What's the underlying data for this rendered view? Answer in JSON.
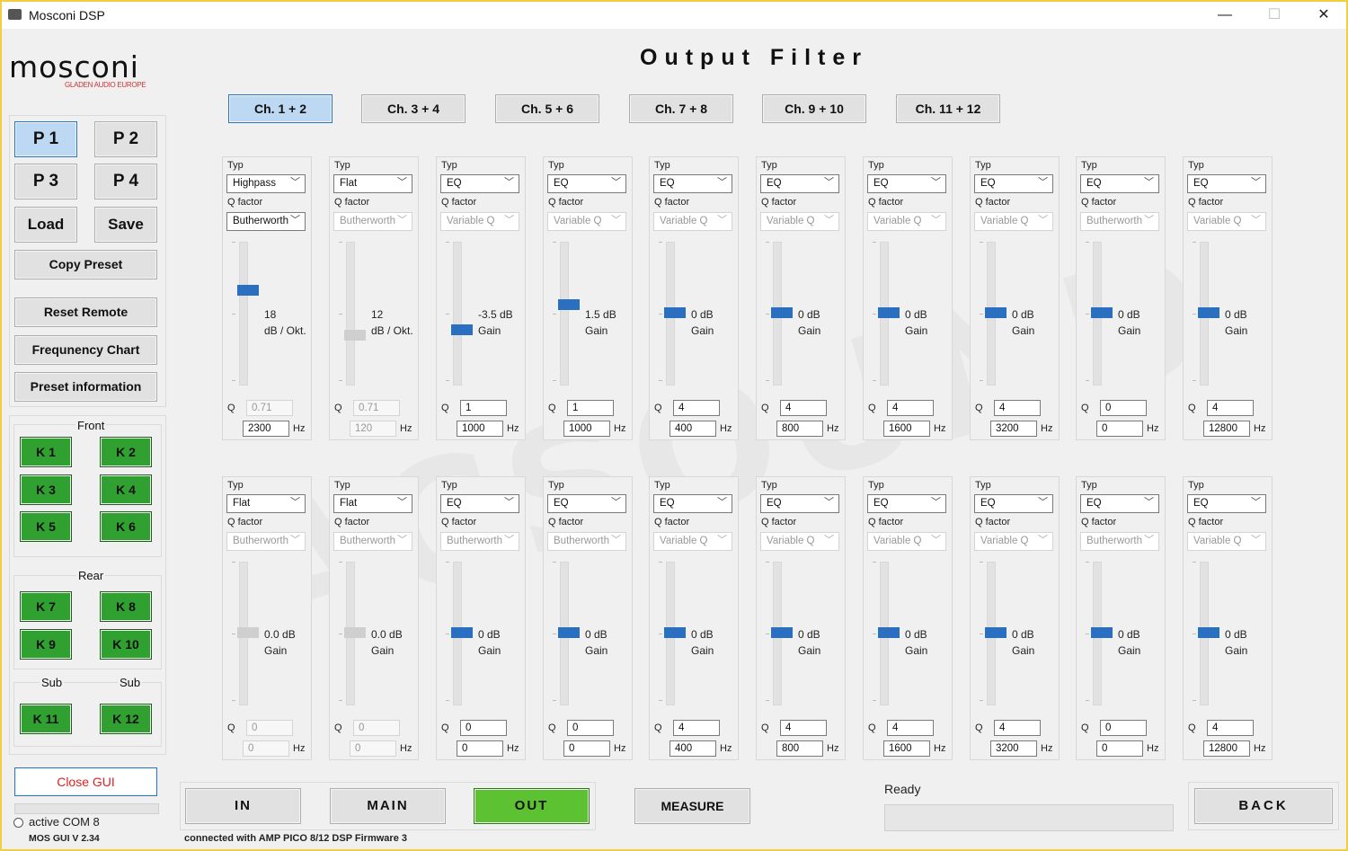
{
  "window": {
    "title": "Mosconi DSP",
    "minimize": "—",
    "maximize": "☐",
    "close": "✕"
  },
  "logo": {
    "word": "mosconi",
    "sub": "GLADEN AUDIO EUROPE"
  },
  "page_title": "Output   Filter",
  "channel_tabs": [
    {
      "label": "Ch. 1 + 2",
      "selected": true
    },
    {
      "label": "Ch. 3 + 4",
      "selected": false
    },
    {
      "label": "Ch. 5 + 6",
      "selected": false
    },
    {
      "label": "Ch. 7 + 8",
      "selected": false
    },
    {
      "label": "Ch. 9 + 10",
      "selected": false
    },
    {
      "label": "Ch. 11 + 12",
      "selected": false
    }
  ],
  "presets": {
    "p1": "P 1",
    "p2": "P 2",
    "p3": "P 3",
    "p4": "P 4",
    "load": "Load",
    "save": "Save",
    "copy": "Copy Preset"
  },
  "sidebar_buttons": {
    "reset": "Reset Remote",
    "freq": "Frequnency Chart",
    "info": "Preset information"
  },
  "speaker_groups": {
    "front_label": "Front",
    "front": [
      "K 1",
      "K 2",
      "K 3",
      "K 4",
      "K 5",
      "K 6"
    ],
    "rear_label": "Rear",
    "rear": [
      "K 7",
      "K 8",
      "K 9",
      "K 10"
    ],
    "sub_left_label": "Sub",
    "sub_right_label": "Sub",
    "sub": [
      "K 11",
      "K 12"
    ]
  },
  "close_gui": "Close GUI",
  "com": {
    "label": "active COM 8",
    "version": "MOS GUI V 2.34"
  },
  "labels": {
    "type": "Typ",
    "qfactor": "Q factor",
    "q": "Q",
    "hz": "Hz"
  },
  "filters_top": [
    {
      "type": "Highpass",
      "qf": "Butherworth",
      "qf_enabled": true,
      "v1": "18",
      "v2": "dB / Okt.",
      "active": true,
      "q": "0.71",
      "q_enabled": false,
      "hz": "2300",
      "hz_enabled": true,
      "level": 0.66
    },
    {
      "type": "Flat",
      "qf": "Butherworth",
      "qf_enabled": false,
      "v1": "12",
      "v2": "dB / Okt.",
      "active": false,
      "q": "0.71",
      "q_enabled": false,
      "hz": "120",
      "hz_enabled": false,
      "level": 0.34
    },
    {
      "type": "EQ",
      "qf": "Variable Q",
      "qf_enabled": false,
      "v1": "-3.5 dB",
      "v2": "Gain",
      "active": true,
      "q": "1",
      "q_enabled": true,
      "hz": "1000",
      "hz_enabled": true,
      "level": 0.38
    },
    {
      "type": "EQ",
      "qf": "Variable Q",
      "qf_enabled": false,
      "v1": "1.5 dB",
      "v2": "Gain",
      "active": true,
      "q": "1",
      "q_enabled": true,
      "hz": "1000",
      "hz_enabled": true,
      "level": 0.56
    },
    {
      "type": "EQ",
      "qf": "Variable Q",
      "qf_enabled": false,
      "v1": "0 dB",
      "v2": "Gain",
      "active": true,
      "q": "4",
      "q_enabled": true,
      "hz": "400",
      "hz_enabled": true,
      "level": 0.5
    },
    {
      "type": "EQ",
      "qf": "Variable Q",
      "qf_enabled": false,
      "v1": "0 dB",
      "v2": "Gain",
      "active": true,
      "q": "4",
      "q_enabled": true,
      "hz": "800",
      "hz_enabled": true,
      "level": 0.5
    },
    {
      "type": "EQ",
      "qf": "Variable Q",
      "qf_enabled": false,
      "v1": "0 dB",
      "v2": "Gain",
      "active": true,
      "q": "4",
      "q_enabled": true,
      "hz": "1600",
      "hz_enabled": true,
      "level": 0.5
    },
    {
      "type": "EQ",
      "qf": "Variable Q",
      "qf_enabled": false,
      "v1": "0 dB",
      "v2": "Gain",
      "active": true,
      "q": "4",
      "q_enabled": true,
      "hz": "3200",
      "hz_enabled": true,
      "level": 0.5
    },
    {
      "type": "EQ",
      "qf": "Butherworth",
      "qf_enabled": false,
      "v1": "0 dB",
      "v2": "Gain",
      "active": true,
      "q": "0",
      "q_enabled": true,
      "hz": "0",
      "hz_enabled": true,
      "level": 0.5
    },
    {
      "type": "EQ",
      "qf": "Variable Q",
      "qf_enabled": false,
      "v1": "0 dB",
      "v2": "Gain",
      "active": true,
      "q": "4",
      "q_enabled": true,
      "hz": "12800",
      "hz_enabled": true,
      "level": 0.5
    }
  ],
  "filters_bottom": [
    {
      "type": "Flat",
      "qf": "Butherworth",
      "qf_enabled": false,
      "v1": "0.0 dB",
      "v2": "Gain",
      "active": false,
      "q": "0",
      "q_enabled": false,
      "hz": "0",
      "hz_enabled": false,
      "level": 0.5
    },
    {
      "type": "Flat",
      "qf": "Butherworth",
      "qf_enabled": false,
      "v1": "0.0 dB",
      "v2": "Gain",
      "active": false,
      "q": "0",
      "q_enabled": false,
      "hz": "0",
      "hz_enabled": false,
      "level": 0.5
    },
    {
      "type": "EQ",
      "qf": "Butherworth",
      "qf_enabled": false,
      "v1": "0 dB",
      "v2": "Gain",
      "active": true,
      "q": "0",
      "q_enabled": true,
      "hz": "0",
      "hz_enabled": true,
      "level": 0.5
    },
    {
      "type": "EQ",
      "qf": "Butherworth",
      "qf_enabled": false,
      "v1": "0 dB",
      "v2": "Gain",
      "active": true,
      "q": "0",
      "q_enabled": true,
      "hz": "0",
      "hz_enabled": true,
      "level": 0.5
    },
    {
      "type": "EQ",
      "qf": "Variable Q",
      "qf_enabled": false,
      "v1": "0 dB",
      "v2": "Gain",
      "active": true,
      "q": "4",
      "q_enabled": true,
      "hz": "400",
      "hz_enabled": true,
      "level": 0.5
    },
    {
      "type": "EQ",
      "qf": "Variable Q",
      "qf_enabled": false,
      "v1": "0 dB",
      "v2": "Gain",
      "active": true,
      "q": "4",
      "q_enabled": true,
      "hz": "800",
      "hz_enabled": true,
      "level": 0.5
    },
    {
      "type": "EQ",
      "qf": "Variable Q",
      "qf_enabled": false,
      "v1": "0 dB",
      "v2": "Gain",
      "active": true,
      "q": "4",
      "q_enabled": true,
      "hz": "1600",
      "hz_enabled": true,
      "level": 0.5
    },
    {
      "type": "EQ",
      "qf": "Variable Q",
      "qf_enabled": false,
      "v1": "0 dB",
      "v2": "Gain",
      "active": true,
      "q": "4",
      "q_enabled": true,
      "hz": "3200",
      "hz_enabled": true,
      "level": 0.5
    },
    {
      "type": "EQ",
      "qf": "Butherworth",
      "qf_enabled": false,
      "v1": "0 dB",
      "v2": "Gain",
      "active": true,
      "q": "0",
      "q_enabled": true,
      "hz": "0",
      "hz_enabled": true,
      "level": 0.5
    },
    {
      "type": "EQ",
      "qf": "Variable Q",
      "qf_enabled": false,
      "v1": "0 dB",
      "v2": "Gain",
      "active": true,
      "q": "4",
      "q_enabled": true,
      "hz": "12800",
      "hz_enabled": true,
      "level": 0.5
    }
  ],
  "nav": {
    "in": "IN",
    "main": "MAIN",
    "out": "OUT",
    "measure": "MEASURE",
    "back": "BACK"
  },
  "status": {
    "ready": "Ready",
    "connection": "connected with AMP PICO 8/12 DSP Firmware 3"
  },
  "colors": {
    "accent": "#2a6fc0",
    "green": "#2ea32e",
    "out_green": "#5cc232",
    "close_red": "#e02020"
  }
}
